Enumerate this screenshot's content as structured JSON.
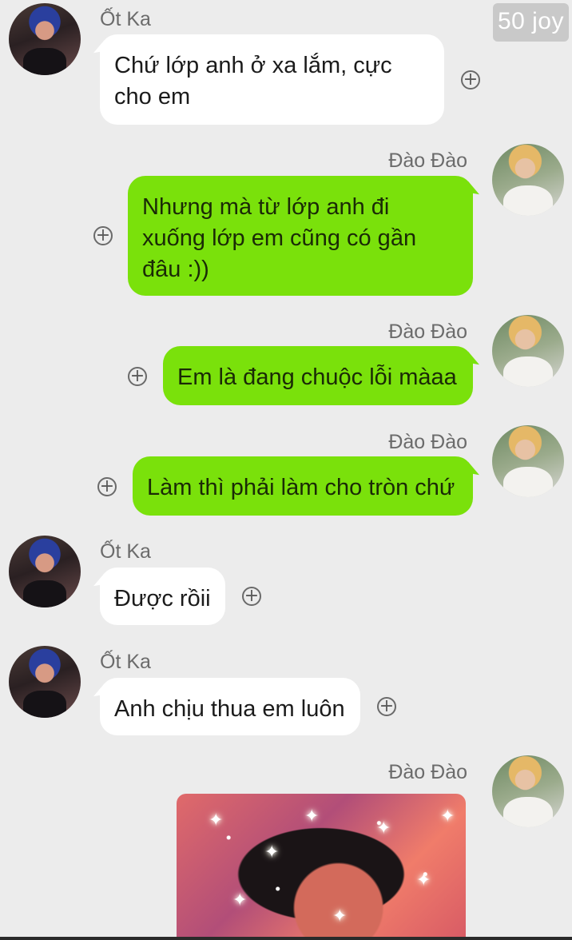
{
  "watermark": "50 joy",
  "messages": [
    {
      "side": "left",
      "sender": "Ốt Ka",
      "lines": [
        "Chứ lớp anh ở xa lắm, cực",
        "cho em"
      ]
    },
    {
      "side": "right",
      "sender": "Đào Đào",
      "lines": [
        "Nhưng mà từ lớp anh đi",
        "xuống lớp em cũng có gần",
        "đâu :))"
      ]
    },
    {
      "side": "right",
      "sender": "Đào Đào",
      "lines": [
        "Em là đang chuộc lỗi màaa"
      ]
    },
    {
      "side": "right",
      "sender": "Đào Đào",
      "lines": [
        "Làm thì phải làm cho tròn chứ"
      ]
    },
    {
      "side": "left",
      "sender": "Ốt Ka",
      "lines": [
        "Được rồii"
      ]
    },
    {
      "side": "left",
      "sender": "Ốt Ka",
      "lines": [
        "Anh chịu thua em luôn"
      ]
    },
    {
      "side": "right",
      "sender": "Đào Đào",
      "sticker": true
    }
  ],
  "icons": {
    "add": "plus-circle-icon",
    "avatar_left": "avatar-ot-ka",
    "avatar_right": "avatar-dao-dao"
  },
  "colors": {
    "background": "#ececec",
    "bubble_incoming": "#ffffff",
    "bubble_outgoing": "#7ae10b"
  }
}
